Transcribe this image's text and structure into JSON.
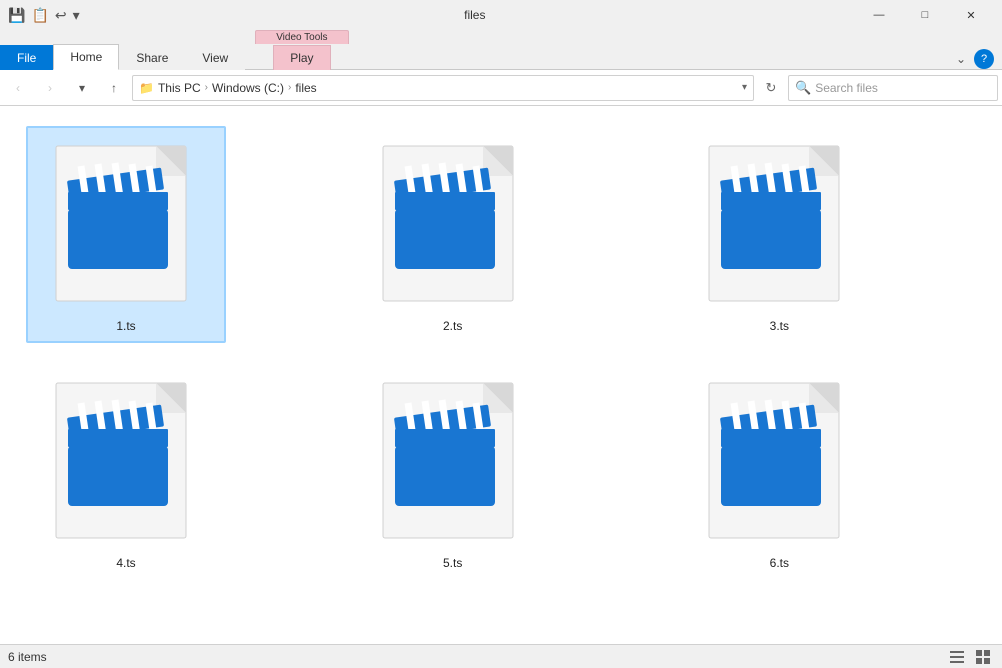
{
  "titleBar": {
    "title": "files",
    "windowControls": {
      "minimize": "—",
      "maximize": "□",
      "close": "✕"
    }
  },
  "quickAccess": {
    "icons": [
      "📄",
      "⬆",
      "▼"
    ]
  },
  "ribbon": {
    "tabs": [
      {
        "label": "File",
        "type": "file"
      },
      {
        "label": "Home",
        "type": "normal"
      },
      {
        "label": "Share",
        "type": "normal"
      },
      {
        "label": "View",
        "type": "normal"
      }
    ],
    "videoTools": {
      "banner": "Video Tools",
      "tabs": [
        {
          "label": "Play",
          "type": "active"
        }
      ]
    },
    "chevron": "⌄",
    "help": "?"
  },
  "addressBar": {
    "back": "‹",
    "forward": "›",
    "up": "↑",
    "breadcrumbs": [
      "This PC",
      "Windows (C:)",
      "files"
    ],
    "dropdownArrow": "▾",
    "refresh": "↻",
    "search": {
      "placeholder": "Search files",
      "icon": "🔍"
    }
  },
  "files": [
    {
      "name": "1.ts",
      "selected": true
    },
    {
      "name": "2.ts",
      "selected": false
    },
    {
      "name": "3.ts",
      "selected": false
    },
    {
      "name": "4.ts",
      "selected": false
    },
    {
      "name": "5.ts",
      "selected": false
    },
    {
      "name": "6.ts",
      "selected": false
    }
  ],
  "statusBar": {
    "itemCount": "6 items",
    "viewIcons": [
      "☰",
      "⊞"
    ]
  }
}
